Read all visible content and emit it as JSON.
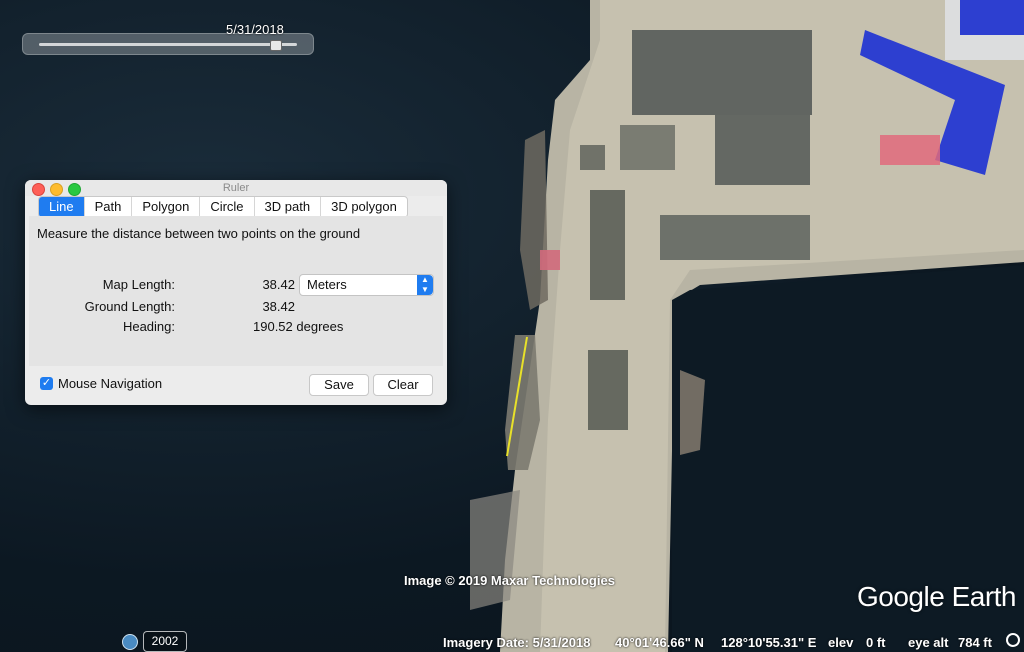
{
  "time_slider": {
    "date": "5/31/2018",
    "position": 0.88
  },
  "ruler": {
    "window_title": "Ruler",
    "tabs": [
      {
        "label": "Line",
        "active": true
      },
      {
        "label": "Path",
        "active": false
      },
      {
        "label": "Polygon",
        "active": false
      },
      {
        "label": "Circle",
        "active": false
      },
      {
        "label": "3D path",
        "active": false
      },
      {
        "label": "3D polygon",
        "active": false
      }
    ],
    "description": "Measure the distance between two points on the ground",
    "map_length_label": "Map Length:",
    "map_length_value": "38.42",
    "unit": "Meters",
    "ground_length_label": "Ground Length:",
    "ground_length_value": "38.42",
    "heading_label": "Heading:",
    "heading_value": "190.52 degrees",
    "mouse_navigation_label": "Mouse Navigation",
    "mouse_navigation_checked": true,
    "save_label": "Save",
    "clear_label": "Clear"
  },
  "map": {
    "copyright": "Image © 2019 Maxar Technologies",
    "logo": "Google Earth",
    "ruler_line_color": "#e8e12a"
  },
  "status": {
    "year": "2002",
    "imagery_date": "Imagery Date: 5/31/2018",
    "latitude": "40°01'46.66\" N",
    "longitude": "128°10'55.31\" E",
    "elev_label": "elev",
    "elev_value": "0 ft",
    "eye_alt_label": "eye alt",
    "eye_alt_value": "784 ft"
  },
  "icons": [
    "clock-icon",
    "compass-icon",
    "checkmark-icon",
    "chevron-updown-icon"
  ]
}
